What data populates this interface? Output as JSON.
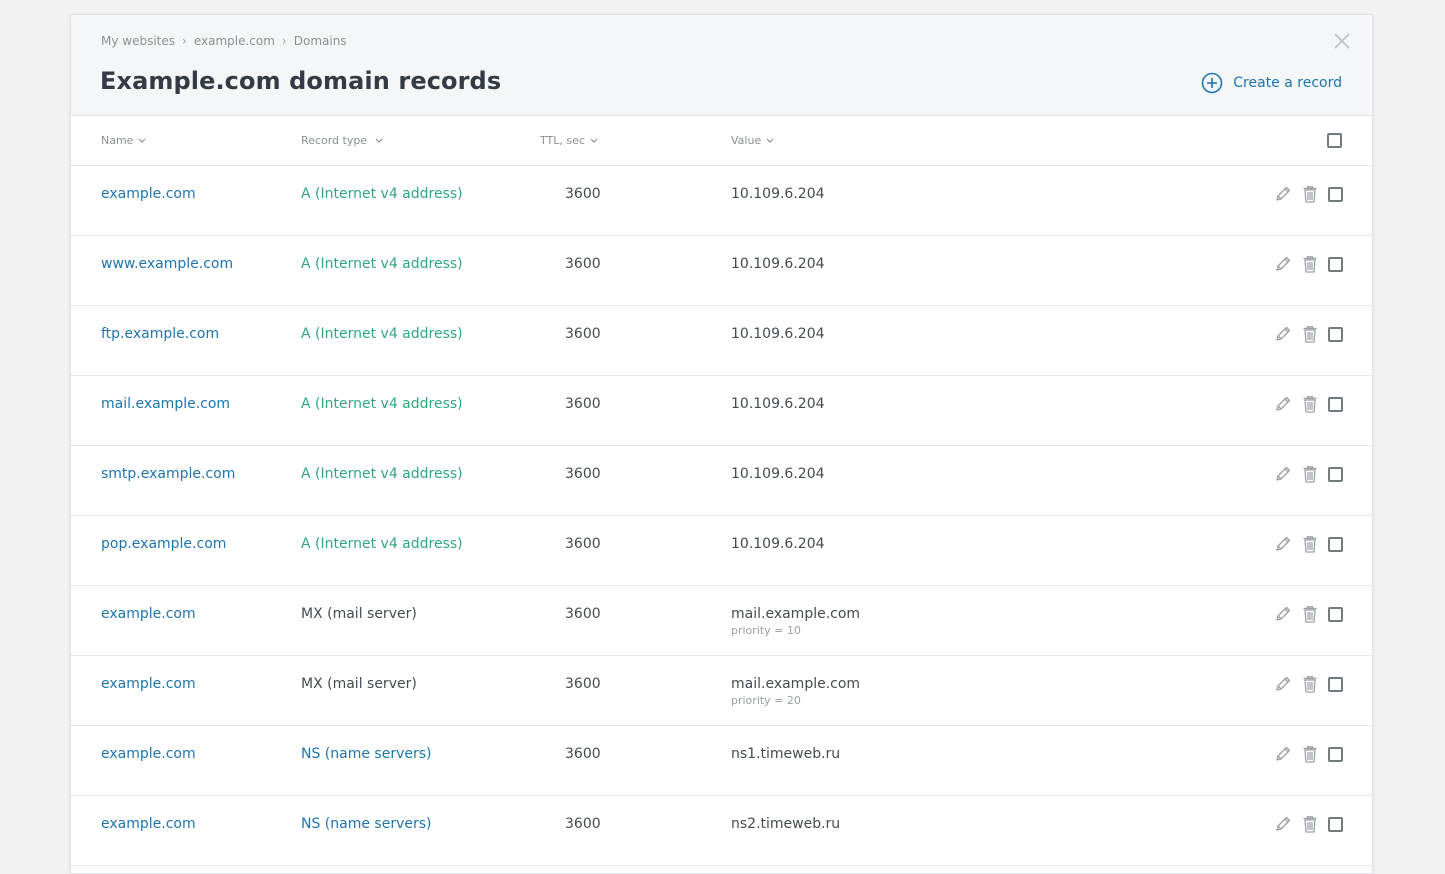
{
  "breadcrumb": {
    "items": [
      "My websites",
      "example.com",
      "Domains"
    ]
  },
  "header": {
    "title": "Example.com domain records",
    "create_label": "Create a record"
  },
  "table": {
    "columns": {
      "name": "Name",
      "type": "Record type",
      "ttl": "TTL, sec",
      "value": "Value"
    },
    "rows": [
      {
        "name": "example.com",
        "type": "A (Internet v4 address)",
        "kind": "a",
        "ttl": "3600",
        "value": "10.109.6.204",
        "sub": ""
      },
      {
        "name": "www.example.com",
        "type": "A (Internet v4 address)",
        "kind": "a",
        "ttl": "3600",
        "value": "10.109.6.204",
        "sub": ""
      },
      {
        "name": "ftp.example.com",
        "type": "A (Internet v4 address)",
        "kind": "a",
        "ttl": "3600",
        "value": "10.109.6.204",
        "sub": ""
      },
      {
        "name": "mail.example.com",
        "type": "A (Internet v4 address)",
        "kind": "a",
        "ttl": "3600",
        "value": "10.109.6.204",
        "sub": ""
      },
      {
        "name": "smtp.example.com",
        "type": "A (Internet v4 address)",
        "kind": "a",
        "ttl": "3600",
        "value": "10.109.6.204",
        "sub": ""
      },
      {
        "name": "pop.example.com",
        "type": "A (Internet v4 address)",
        "kind": "a",
        "ttl": "3600",
        "value": "10.109.6.204",
        "sub": ""
      },
      {
        "name": "example.com",
        "type": "MX (mail server)",
        "kind": "mx",
        "ttl": "3600",
        "value": "mail.example.com",
        "sub": "priority = 10"
      },
      {
        "name": "example.com",
        "type": "MX (mail server)",
        "kind": "mx",
        "ttl": "3600",
        "value": "mail.example.com",
        "sub": "priority = 20"
      },
      {
        "name": "example.com",
        "type": "NS (name servers)",
        "kind": "ns",
        "ttl": "3600",
        "value": "ns1.timeweb.ru",
        "sub": ""
      },
      {
        "name": "example.com",
        "type": "NS (name servers)",
        "kind": "ns",
        "ttl": "3600",
        "value": "ns2.timeweb.ru",
        "sub": ""
      }
    ]
  },
  "colors": {
    "link": "#1e75ac",
    "a_record": "#30a77e",
    "text": "#444b52",
    "muted": "#8a9096"
  },
  "icons": {
    "close": "close-icon",
    "create": "plus-circle-icon",
    "sort": "chevron-down-icon",
    "edit": "pencil-icon",
    "delete": "trash-icon"
  }
}
